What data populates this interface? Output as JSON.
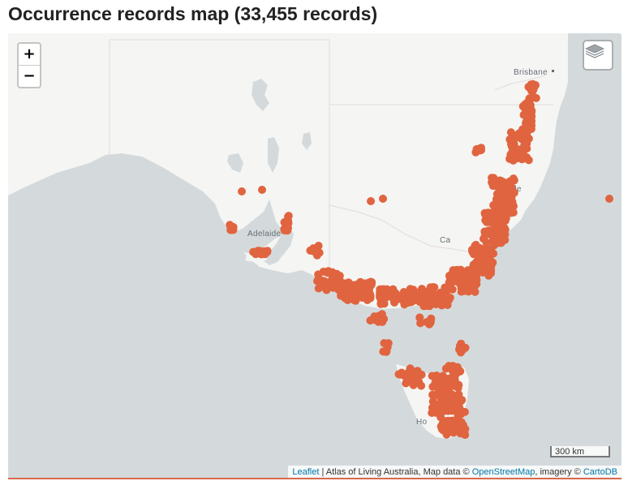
{
  "title": "Occurrence records map (33,455 records)",
  "zoom": {
    "in_label": "+",
    "out_label": "−"
  },
  "layers_control": {
    "icon": "layers-icon"
  },
  "places": {
    "brisbane": "Brisbane",
    "adelaide": "Adelaide",
    "newcastle": "stle",
    "canberra": "Ca",
    "hobart": "Ho"
  },
  "scale": {
    "label": "300 km"
  },
  "attribution": {
    "leaflet": "Leaflet",
    "sep1": " | Atlas of Living Australia, Map data © ",
    "osm": "OpenStreetMap",
    "sep2": ", imagery © ",
    "carto": "CartoDB"
  },
  "colors": {
    "points": "#e0643f",
    "land": "#f5f5f3",
    "water": "#d4dadc",
    "borders": "#e2dcdc"
  }
}
